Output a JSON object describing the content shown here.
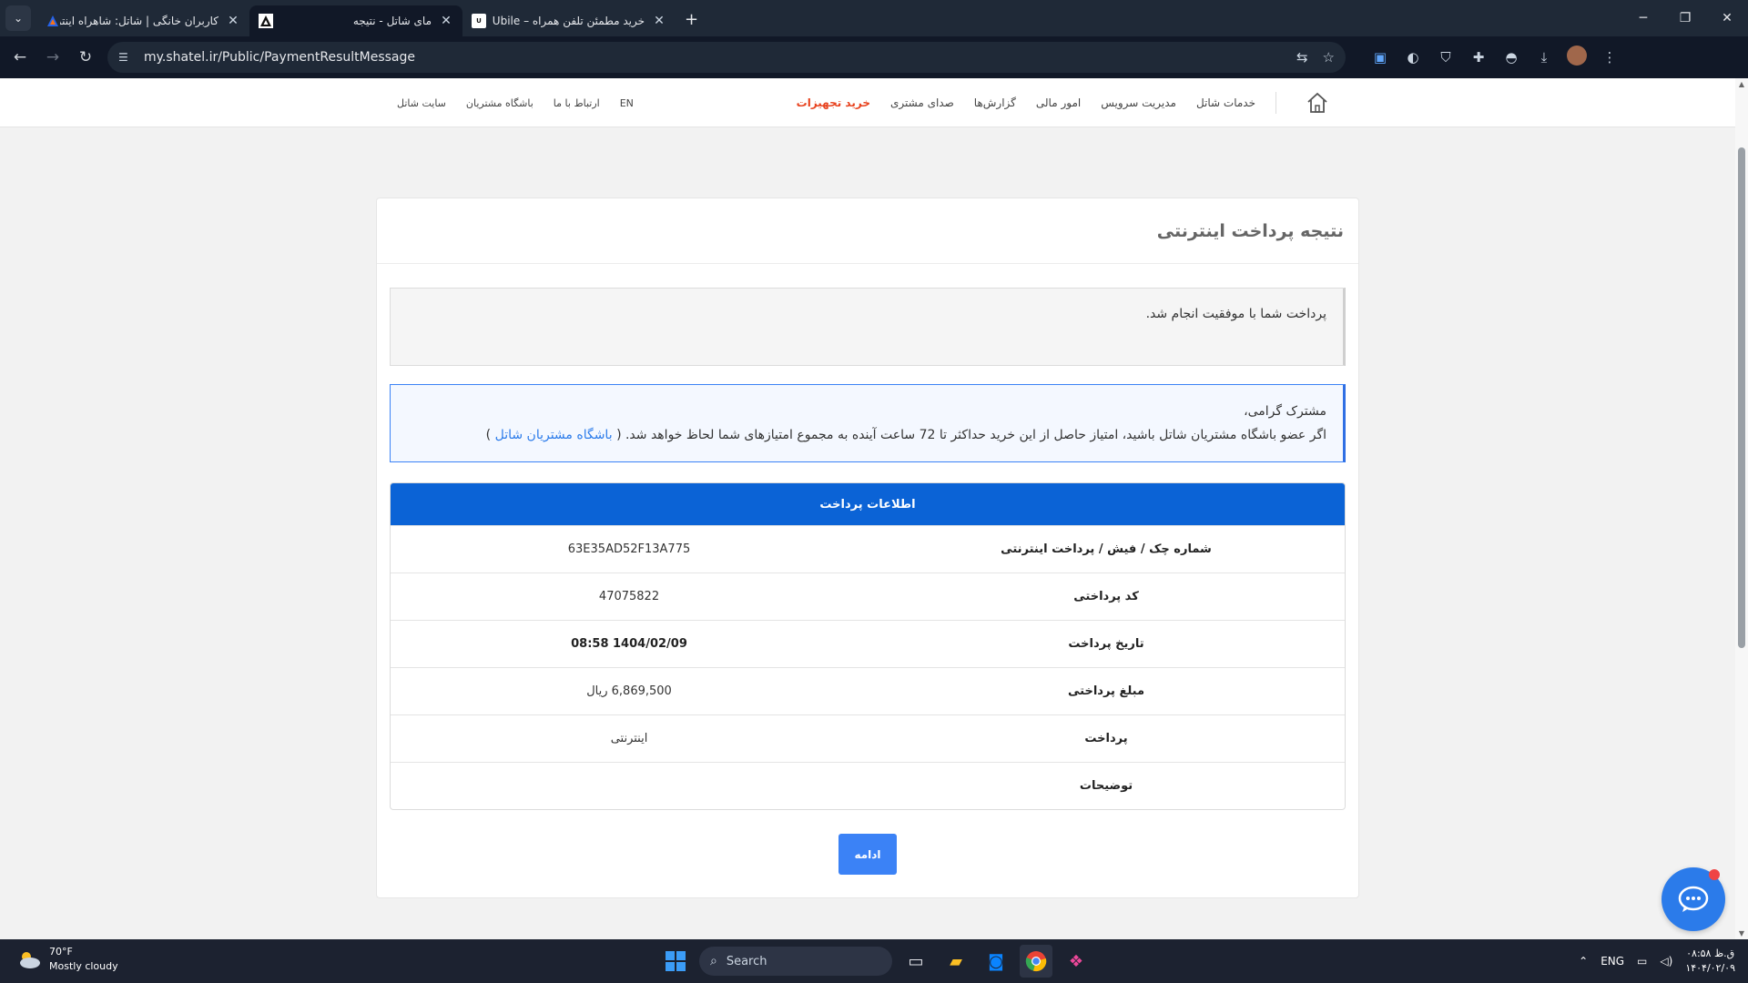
{
  "browser": {
    "tabs": [
      {
        "title": "کاربران خانگی | شاتل: شاهراه اینترنت",
        "active": false
      },
      {
        "title": "مای شاتل - نتیجه",
        "active": true
      },
      {
        "title": "خرید مطمئن تلفن همراه – Ubile",
        "active": false
      }
    ],
    "url": "my.shatel.ir/Public/PaymentResultMessage"
  },
  "site": {
    "main_nav": [
      "خدمات شاتل",
      "مدیریت سرویس",
      "امور مالی",
      "گزارش‌ها",
      "صدای مشتری",
      "خرید تجهیزات"
    ],
    "top_nav": [
      "EN",
      "ارتباط با ما",
      "باشگاه مشتریان",
      "سایت شاتل"
    ]
  },
  "card": {
    "title": "نتیجه پرداخت اینترنتی",
    "success_message": "پرداخت شما با موفقیت انجام شد.",
    "info_greeting": "مشترک گرامی،",
    "info_text_before": "اگر عضو باشگاه مشتریان شاتل باشید، امتیاز حاصل از این خرید حداکثر تا 72 ساعت آینده به مجموع امتیازهای شما لحاظ خواهد شد. (",
    "info_link": "باشگاه مشتریان شاتل",
    "info_text_after": ")",
    "table_header": "اطلاعات پرداخت",
    "rows": [
      {
        "label": "شماره چک / فیش / پرداخت اینترنتی",
        "value": "63E35AD52F13A775"
      },
      {
        "label": "کد پرداختی",
        "value": "47075822"
      },
      {
        "label": "تاریخ پرداخت",
        "value": "08:58 1404/02/09"
      },
      {
        "label": "مبلغ پرداختی",
        "value": "6,869,500 ریال"
      },
      {
        "label": "پرداخت",
        "value": "اینترنتی"
      },
      {
        "label": "توضیحات",
        "value": ""
      }
    ],
    "continue_label": "ادامه"
  },
  "taskbar": {
    "weather_temp": "70°F",
    "weather_desc": "Mostly cloudy",
    "search_label": "Search",
    "lang": "ENG",
    "time": "۰۸:۵۸ ق.ظ",
    "date": "۱۴۰۴/۰۲/۰۹"
  }
}
